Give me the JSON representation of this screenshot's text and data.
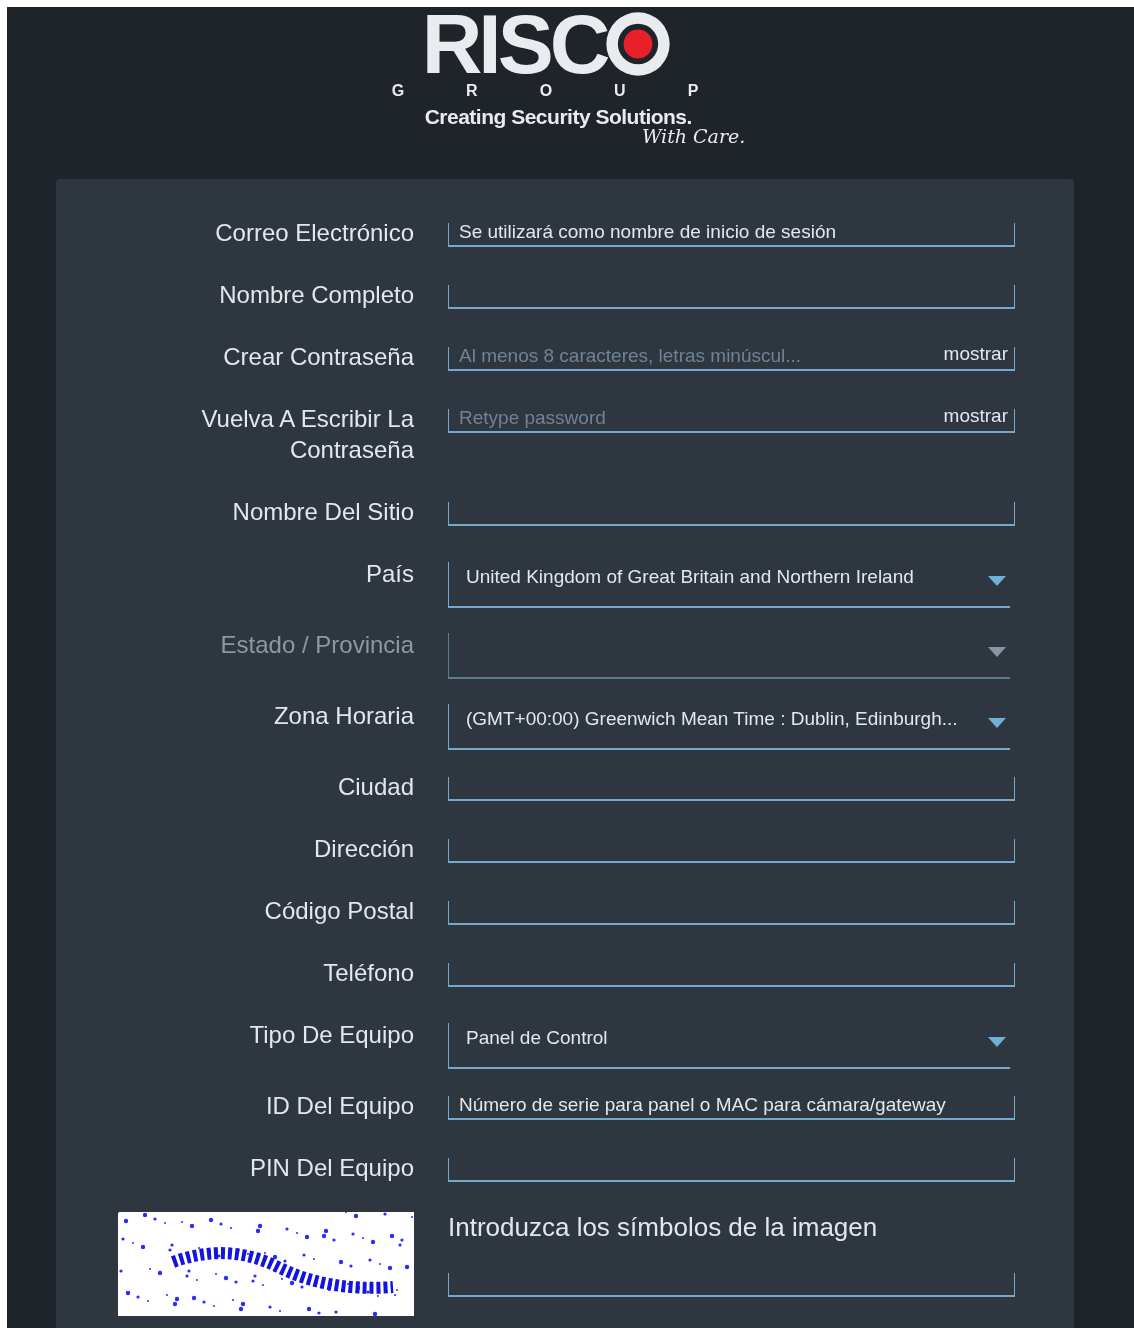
{
  "logo": {
    "wordmark": "RISC",
    "group": "GROUP",
    "tagline": "Creating Security Solutions.",
    "signature": "With Care."
  },
  "form": {
    "fields": [
      {
        "kind": "text",
        "label": "Correo Electrónico",
        "placeholder": "Se utilizará como nombre de inicio de sesión",
        "disabled": false
      },
      {
        "kind": "text",
        "label": "Nombre Completo",
        "disabled": false
      },
      {
        "kind": "password",
        "label": "Crear Contraseña",
        "placeholder": "Al menos 8 caracteres, letras minúscul...",
        "show_label": "mostrar",
        "disabled": false
      },
      {
        "kind": "password",
        "label": "Vuelva A Escribir La Contraseña",
        "placeholder": "Retype password",
        "show_label": "mostrar",
        "disabled": false
      },
      {
        "kind": "text",
        "label": "Nombre Del Sitio",
        "disabled": false
      },
      {
        "kind": "select",
        "label": "País",
        "value": "United Kingdom of Great Britain and Northern Ireland",
        "disabled": false
      },
      {
        "kind": "select",
        "label": "Estado / Provincia",
        "disabled": true
      },
      {
        "kind": "select",
        "label": "Zona Horaria",
        "value": "(GMT+00:00) Greenwich Mean Time : Dublin, Edinburgh...",
        "disabled": false
      },
      {
        "kind": "text",
        "label": "Ciudad",
        "disabled": false
      },
      {
        "kind": "text",
        "label": "Dirección",
        "disabled": false
      },
      {
        "kind": "text",
        "label": "Código Postal",
        "disabled": false
      },
      {
        "kind": "text",
        "label": "Teléfono",
        "disabled": false
      },
      {
        "kind": "select",
        "label": "Tipo De Equipo",
        "value": "Panel de Control",
        "disabled": false
      },
      {
        "kind": "text",
        "label": "ID Del Equipo",
        "placeholder": "Número de serie para panel o MAC para cámara/gateway",
        "disabled": false
      },
      {
        "kind": "text",
        "label": "PIN Del Equipo",
        "disabled": false
      }
    ],
    "captcha": {
      "prompt": "Introduzca los símbolos de la imagen"
    }
  }
}
